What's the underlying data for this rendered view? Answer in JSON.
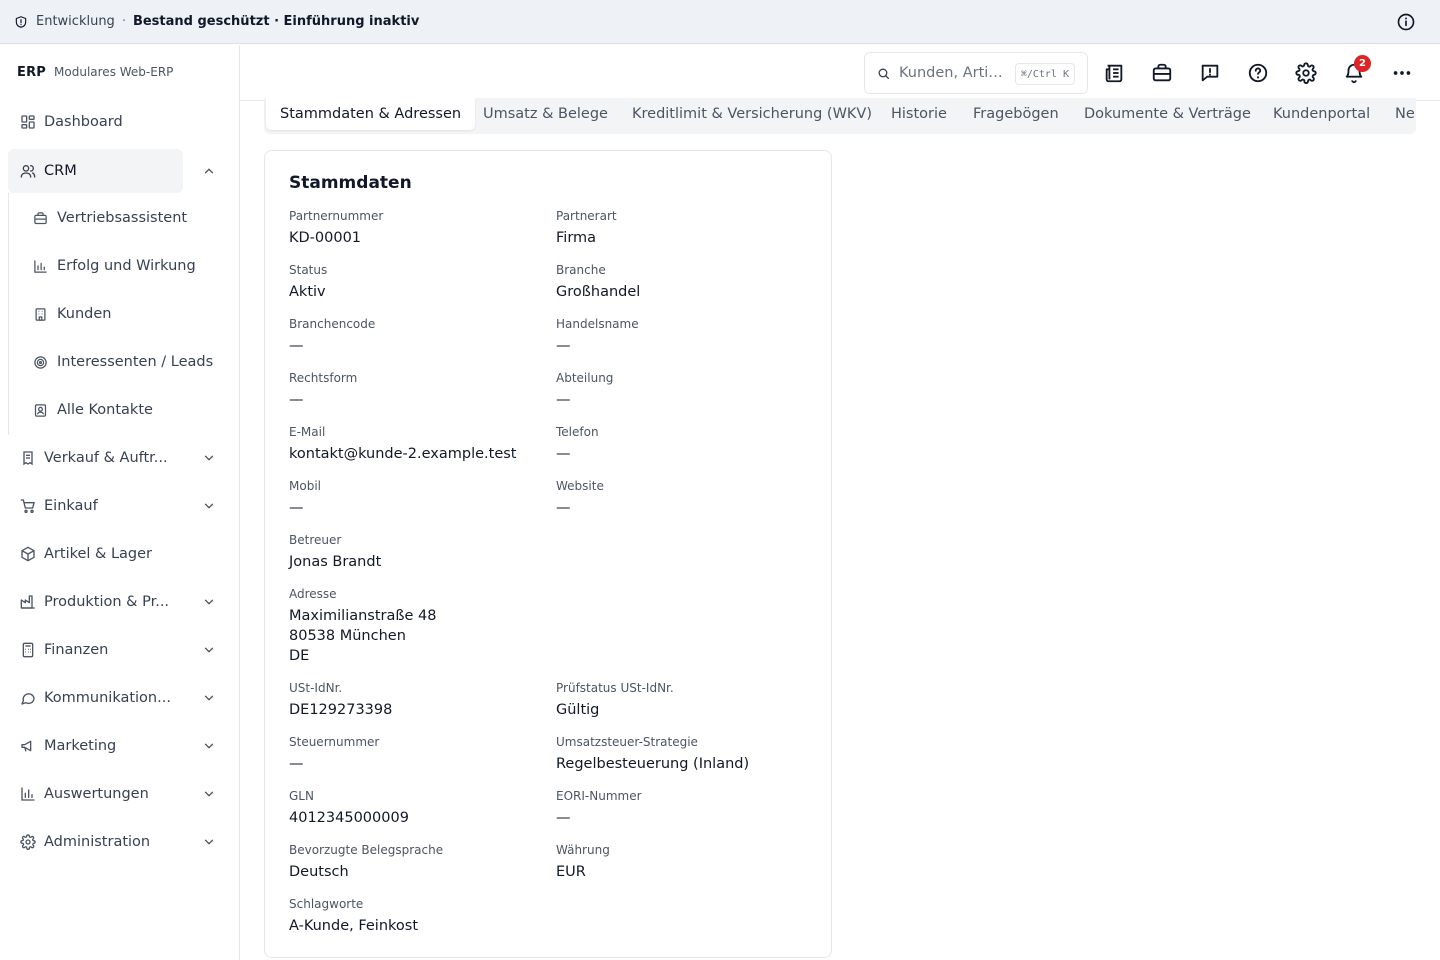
{
  "banner": {
    "environment": "Entwicklung",
    "separator": "·",
    "status": "Bestand geschützt · Einführung inaktiv"
  },
  "brand": {
    "logo": "ERP",
    "subtitle": "Modulares Web-ERP"
  },
  "sidebar": {
    "items": [
      {
        "label": "Dashboard",
        "icon": "dashboard-icon"
      },
      {
        "label": "CRM",
        "icon": "users-icon",
        "expanded": true
      },
      {
        "label": "Verkauf & Auftr...",
        "icon": "receipt-icon"
      },
      {
        "label": "Einkauf",
        "icon": "cart-icon"
      },
      {
        "label": "Artikel & Lager",
        "icon": "box-icon"
      },
      {
        "label": "Produktion & Pr...",
        "icon": "factory-icon"
      },
      {
        "label": "Finanzen",
        "icon": "calculator-icon"
      },
      {
        "label": "Kommunikation...",
        "icon": "chat-icon"
      },
      {
        "label": "Marketing",
        "icon": "megaphone-icon"
      },
      {
        "label": "Auswertungen",
        "icon": "bar-chart-icon"
      },
      {
        "label": "Administration",
        "icon": "gear-icon"
      }
    ],
    "crm_subitems": [
      {
        "label": "Vertriebsassistent",
        "icon": "briefcase-icon"
      },
      {
        "label": "Erfolg und Wirkung",
        "icon": "chart-icon"
      },
      {
        "label": "Kunden",
        "icon": "building-icon"
      },
      {
        "label": "Interessenten / Leads",
        "icon": "target-icon"
      },
      {
        "label": "Alle Kontakte",
        "icon": "contact-card-icon"
      }
    ]
  },
  "toolbar": {
    "search_placeholder": "Kunden, Artik...",
    "shortcut": "⌘/Ctrl K",
    "notification_count": "2"
  },
  "tabs": [
    {
      "label": "Stammdaten & Adressen",
      "active": true
    },
    {
      "label": "Umsatz & Belege"
    },
    {
      "label": "Kreditlimit & Versicherung (WKV)"
    },
    {
      "label": "Historie"
    },
    {
      "label": "Fragebögen"
    },
    {
      "label": "Dokumente & Verträge"
    },
    {
      "label": "Kundenportal"
    },
    {
      "label": "Ne"
    }
  ],
  "card": {
    "title": "Stammdaten",
    "fields": {
      "partnernummer": {
        "label": "Partnernummer",
        "value": "KD-00001"
      },
      "partnerart": {
        "label": "Partnerart",
        "value": "Firma"
      },
      "status": {
        "label": "Status",
        "value": "Aktiv"
      },
      "branche": {
        "label": "Branche",
        "value": "Großhandel"
      },
      "branchencode": {
        "label": "Branchencode",
        "value": "—"
      },
      "handelsname": {
        "label": "Handelsname",
        "value": "—"
      },
      "rechtsform": {
        "label": "Rechtsform",
        "value": "—"
      },
      "abteilung": {
        "label": "Abteilung",
        "value": "—"
      },
      "email": {
        "label": "E-Mail",
        "value": "kontakt@kunde-2.example.test"
      },
      "telefon": {
        "label": "Telefon",
        "value": "—"
      },
      "mobil": {
        "label": "Mobil",
        "value": "—"
      },
      "website": {
        "label": "Website",
        "value": "—"
      },
      "betreuer": {
        "label": "Betreuer",
        "value": "Jonas Brandt"
      },
      "adresse": {
        "label": "Adresse",
        "line1": "Maximilianstraße 48",
        "line2": "80538 München",
        "line3": "DE"
      },
      "ustid": {
        "label": "USt-IdNr.",
        "value": "DE129273398"
      },
      "pruefstatus": {
        "label": "Prüfstatus USt-IdNr.",
        "value": "Gültig"
      },
      "steuernummer": {
        "label": "Steuernummer",
        "value": "—"
      },
      "ust_strategie": {
        "label": "Umsatzsteuer-Strategie",
        "value": "Regelbesteuerung (Inland)"
      },
      "gln": {
        "label": "GLN",
        "value": "4012345000009"
      },
      "eori": {
        "label": "EORI-Nummer",
        "value": "—"
      },
      "belegsprache": {
        "label": "Bevorzugte Belegsprache",
        "value": "Deutsch"
      },
      "waehrung": {
        "label": "Währung",
        "value": "EUR"
      },
      "schlagworte": {
        "label": "Schlagworte",
        "value": "A-Kunde, Feinkost"
      }
    }
  }
}
